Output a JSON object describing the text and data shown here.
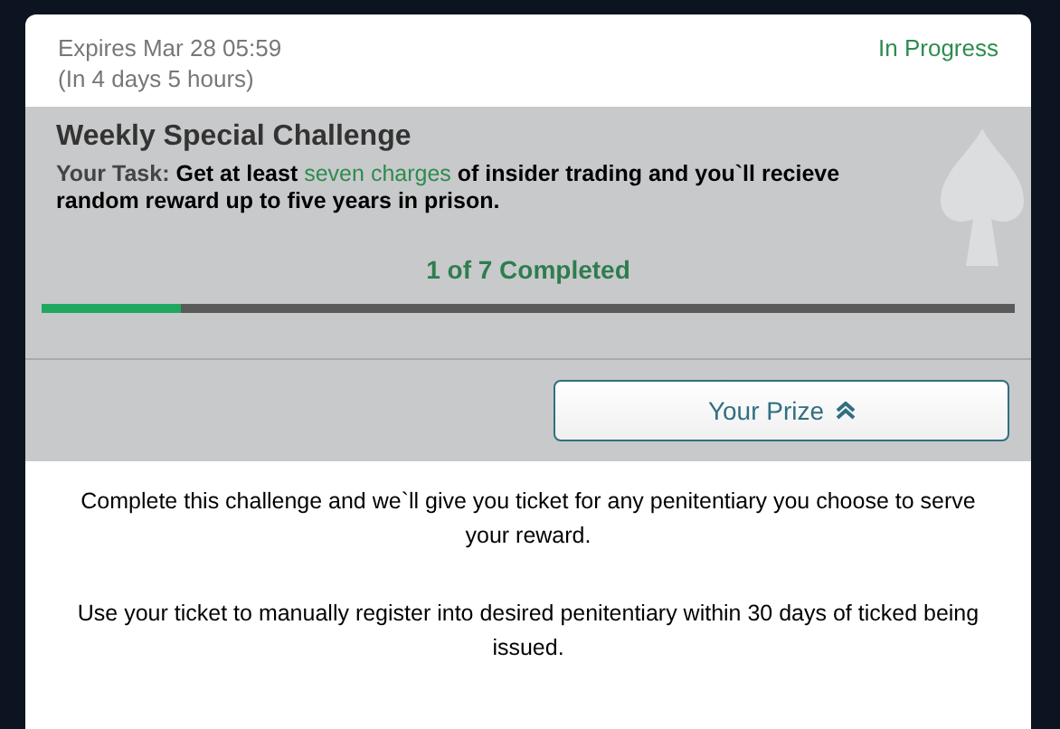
{
  "header": {
    "expires": "Expires Mar 28 05:59",
    "remaining": "(In 4 days 5 hours)",
    "status": "In Progress"
  },
  "challenge": {
    "title": "Weekly Special Challenge",
    "task_label": "Your Task:",
    "task_before": "Get at least",
    "task_highlight": "seven charges",
    "task_after": "of insider trading and you`ll recieve random reward up to five years in prison.",
    "progress_text": "1 of 7 Completed",
    "level": 0.143
  },
  "prize": {
    "label": "Your Prize",
    "expanded": true,
    "paragraphs": [
      "Complete this challenge and we`ll give you ticket for any penitentiary you choose to serve your reward.",
      "Use your ticket to manually register into desired penitentiary within 30 days of ticked being issued."
    ]
  }
}
